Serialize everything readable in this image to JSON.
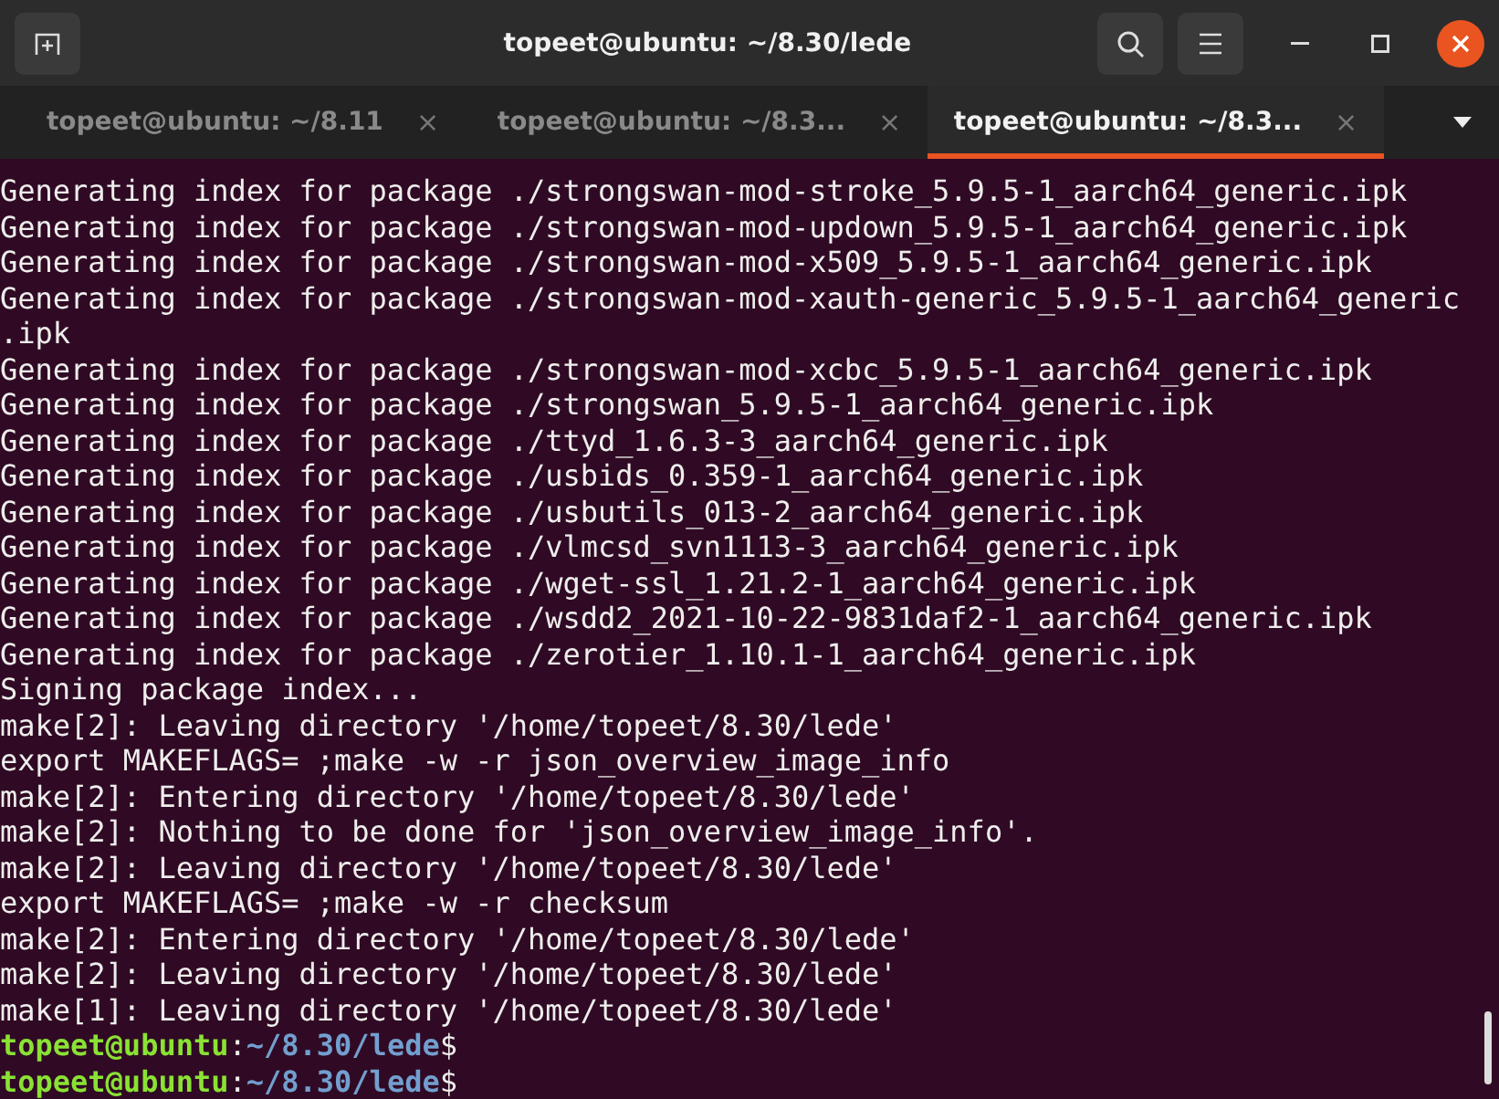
{
  "window": {
    "title": "topeet@ubuntu: ~/8.30/lede"
  },
  "tabs": [
    {
      "label": "topeet@ubuntu: ~/8.11",
      "close": "×",
      "selected": false
    },
    {
      "label": "topeet@ubuntu: ~/8.3...",
      "close": "×",
      "selected": false
    },
    {
      "label": "topeet@ubuntu: ~/8.3...",
      "close": "×",
      "selected": true
    }
  ],
  "terminal": {
    "lines": [
      {
        "kind": "output",
        "text": "Generating index for package ./strongswan-mod-stroke_5.9.5-1_aarch64_generic.ipk"
      },
      {
        "kind": "output",
        "text": "Generating index for package ./strongswan-mod-updown_5.9.5-1_aarch64_generic.ipk"
      },
      {
        "kind": "output",
        "text": "Generating index for package ./strongswan-mod-x509_5.9.5-1_aarch64_generic.ipk"
      },
      {
        "kind": "output",
        "text": "Generating index for package ./strongswan-mod-xauth-generic_5.9.5-1_aarch64_generic"
      },
      {
        "kind": "output",
        "text": ".ipk"
      },
      {
        "kind": "output",
        "text": "Generating index for package ./strongswan-mod-xcbc_5.9.5-1_aarch64_generic.ipk"
      },
      {
        "kind": "output",
        "text": "Generating index for package ./strongswan_5.9.5-1_aarch64_generic.ipk"
      },
      {
        "kind": "output",
        "text": "Generating index for package ./ttyd_1.6.3-3_aarch64_generic.ipk"
      },
      {
        "kind": "output",
        "text": "Generating index for package ./usbids_0.359-1_aarch64_generic.ipk"
      },
      {
        "kind": "output",
        "text": "Generating index for package ./usbutils_013-2_aarch64_generic.ipk"
      },
      {
        "kind": "output",
        "text": "Generating index for package ./vlmcsd_svn1113-3_aarch64_generic.ipk"
      },
      {
        "kind": "output",
        "text": "Generating index for package ./wget-ssl_1.21.2-1_aarch64_generic.ipk"
      },
      {
        "kind": "output",
        "text": "Generating index for package ./wsdd2_2021-10-22-9831daf2-1_aarch64_generic.ipk"
      },
      {
        "kind": "output",
        "text": "Generating index for package ./zerotier_1.10.1-1_aarch64_generic.ipk"
      },
      {
        "kind": "output",
        "text": "Signing package index..."
      },
      {
        "kind": "output",
        "text": "make[2]: Leaving directory '/home/topeet/8.30/lede'"
      },
      {
        "kind": "output",
        "text": "export MAKEFLAGS= ;make -w -r json_overview_image_info"
      },
      {
        "kind": "output",
        "text": "make[2]: Entering directory '/home/topeet/8.30/lede'"
      },
      {
        "kind": "output",
        "text": "make[2]: Nothing to be done for 'json_overview_image_info'."
      },
      {
        "kind": "output",
        "text": "make[2]: Leaving directory '/home/topeet/8.30/lede'"
      },
      {
        "kind": "output",
        "text": "export MAKEFLAGS= ;make -w -r checksum"
      },
      {
        "kind": "output",
        "text": "make[2]: Entering directory '/home/topeet/8.30/lede'"
      },
      {
        "kind": "output",
        "text": "make[2]: Leaving directory '/home/topeet/8.30/lede'"
      },
      {
        "kind": "output",
        "text": "make[1]: Leaving directory '/home/topeet/8.30/lede'"
      },
      {
        "kind": "prompt",
        "user_host": "topeet@ubuntu",
        "separator": ":",
        "path": "~/8.30/lede",
        "symbol": "$"
      },
      {
        "kind": "prompt",
        "user_host": "topeet@ubuntu",
        "separator": ":",
        "path": "~/8.30/lede",
        "symbol": "$"
      }
    ]
  }
}
